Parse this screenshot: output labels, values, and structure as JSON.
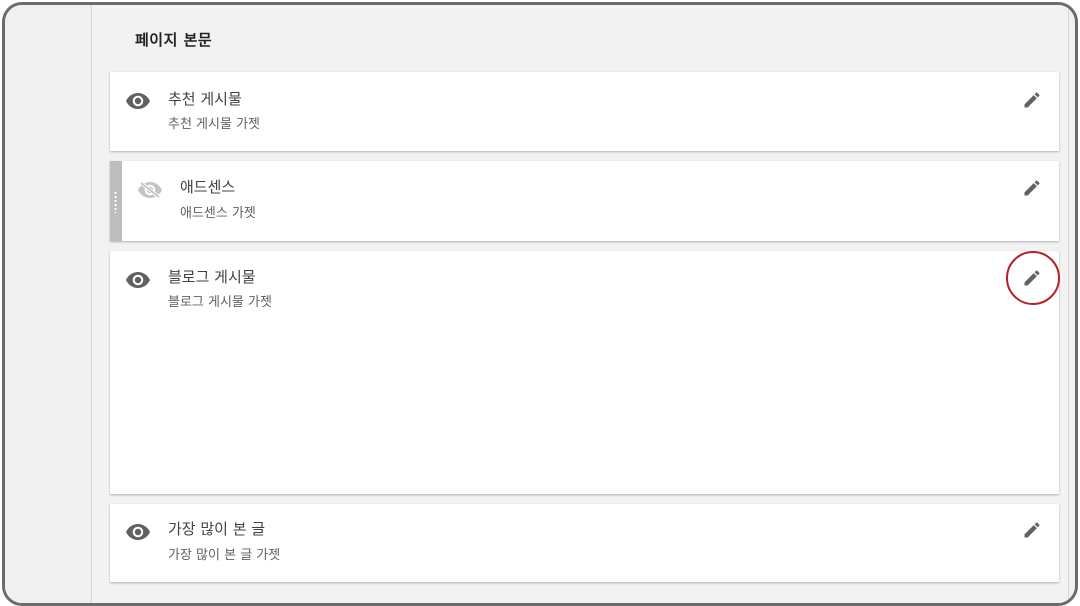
{
  "section": {
    "title": "페이지 본문"
  },
  "gadgets": [
    {
      "title": "추천 게시물",
      "subtitle": "추천 게시물 가젯",
      "visible": true,
      "icon": "eye-icon"
    },
    {
      "title": "애드센스",
      "subtitle": "애드센스 가젯",
      "visible": false,
      "icon": "eye-off-icon"
    },
    {
      "title": "블로그 게시물",
      "subtitle": "블로그 게시물 가젯",
      "visible": true,
      "icon": "eye-icon"
    },
    {
      "title": "가장 많이 본 글",
      "subtitle": "가장 많이 본 글 가젯",
      "visible": true,
      "icon": "eye-icon"
    }
  ],
  "icons": {
    "edit": "pencil-icon",
    "drag": "drag-handle-icon"
  },
  "colors": {
    "highlight": "#b3202a",
    "icon": "#616161",
    "icon_hidden": "#bdbdbd"
  }
}
